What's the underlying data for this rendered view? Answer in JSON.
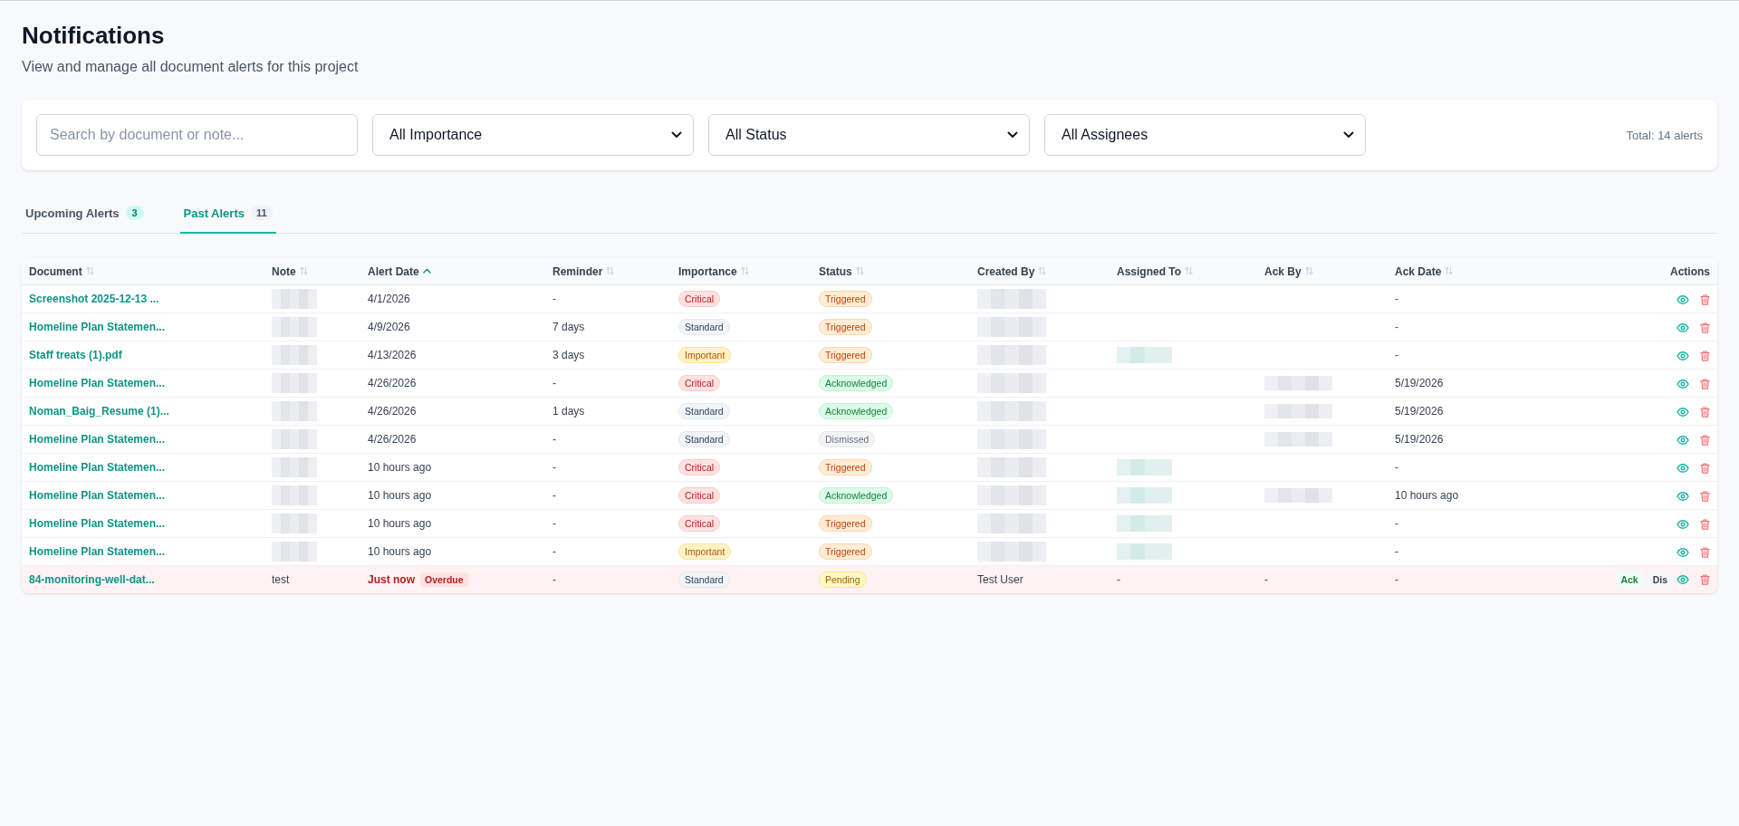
{
  "page": {
    "title": "Notifications",
    "subtitle": "View and manage all document alerts for this project"
  },
  "filters": {
    "search": {
      "placeholder": "Search by document or note..."
    },
    "dropdowns": [
      {
        "value": "All Importance"
      },
      {
        "value": "All Status"
      },
      {
        "value": "All Assignees"
      }
    ],
    "total": "Total: 14 alerts"
  },
  "tabs": [
    {
      "label": "Upcoming Alerts",
      "count": "3",
      "selected": false
    },
    {
      "label": "Past Alerts",
      "count": "11",
      "selected": true
    }
  ],
  "table": {
    "columns": [
      {
        "label": "Document",
        "sortable": true,
        "sorted": false
      },
      {
        "label": "Note",
        "sortable": true,
        "sorted": false
      },
      {
        "label": "Alert Date",
        "sortable": true,
        "sorted": true
      },
      {
        "label": "Reminder",
        "sortable": true,
        "sorted": false
      },
      {
        "label": "Importance",
        "sortable": true,
        "sorted": false
      },
      {
        "label": "Status",
        "sortable": true,
        "sorted": false
      },
      {
        "label": "Created By",
        "sortable": true,
        "sorted": false
      },
      {
        "label": "Assigned To",
        "sortable": true,
        "sorted": false
      },
      {
        "label": "Ack By",
        "sortable": true,
        "sorted": false
      },
      {
        "label": "Ack Date",
        "sortable": true,
        "sorted": false
      },
      {
        "label": "Actions",
        "sortable": false
      }
    ],
    "rows": [
      {
        "overdue": false,
        "document": "Screenshot 2025-12-13 ...",
        "note": {
          "redacted": true
        },
        "alert_date": "4/1/2026",
        "reminder": "-",
        "importance": {
          "label": "Critical",
          "kind": "critical"
        },
        "status": {
          "label": "Triggered",
          "kind": "triggered"
        },
        "created_by": {
          "redacted": true
        },
        "ack_date": "-"
      },
      {
        "overdue": false,
        "document": "Homeline Plan Statemen...",
        "note": {
          "redacted": true
        },
        "alert_date": "4/9/2026",
        "reminder": "7 days",
        "importance": {
          "label": "Standard",
          "kind": "standard"
        },
        "status": {
          "label": "Triggered",
          "kind": "triggered"
        },
        "created_by": {
          "redacted": true
        },
        "ack_date": "-"
      },
      {
        "overdue": false,
        "document": "Staff treats (1).pdf",
        "note": {
          "redacted": true
        },
        "alert_date": "4/13/2026",
        "reminder": "3 days",
        "importance": {
          "label": "Important",
          "kind": "important"
        },
        "status": {
          "label": "Triggered",
          "kind": "triggered"
        },
        "created_by": {
          "redacted": true
        },
        "assigned_to": {
          "redacted": true,
          "link": true
        },
        "ack_date": "-"
      },
      {
        "overdue": false,
        "document": "Homeline Plan Statemen...",
        "note": {
          "redacted": true
        },
        "alert_date": "4/26/2026",
        "reminder": "-",
        "importance": {
          "label": "Critical",
          "kind": "critical"
        },
        "status": {
          "label": "Acknowledged",
          "kind": "acknowledged"
        },
        "created_by": {
          "redacted": true
        },
        "ack_by": {
          "redacted": true
        },
        "ack_date": "5/19/2026"
      },
      {
        "overdue": false,
        "document": "Noman_Baig_Resume (1)...",
        "note": {
          "redacted": true
        },
        "alert_date": "4/26/2026",
        "reminder": "1 days",
        "importance": {
          "label": "Standard",
          "kind": "standard"
        },
        "status": {
          "label": "Acknowledged",
          "kind": "acknowledged"
        },
        "created_by": {
          "redacted": true
        },
        "ack_by": {
          "redacted": true
        },
        "ack_date": "5/19/2026"
      },
      {
        "overdue": false,
        "document": "Homeline Plan Statemen...",
        "note": {
          "redacted": true
        },
        "alert_date": "4/26/2026",
        "reminder": "-",
        "importance": {
          "label": "Standard",
          "kind": "standard"
        },
        "status": {
          "label": "Dismissed",
          "kind": "dismissed"
        },
        "created_by": {
          "redacted": true
        },
        "ack_by": {
          "redacted": true
        },
        "ack_date": "5/19/2026"
      },
      {
        "overdue": false,
        "document": "Homeline Plan Statemen...",
        "note": {
          "redacted": true
        },
        "alert_date": "10 hours ago",
        "reminder": "-",
        "importance": {
          "label": "Critical",
          "kind": "critical"
        },
        "status": {
          "label": "Triggered",
          "kind": "triggered"
        },
        "created_by": {
          "redacted": true
        },
        "assigned_to": {
          "redacted": true,
          "link": true
        },
        "ack_date": "-"
      },
      {
        "overdue": false,
        "document": "Homeline Plan Statemen...",
        "note": {
          "redacted": true
        },
        "alert_date": "10 hours ago",
        "reminder": "-",
        "importance": {
          "label": "Critical",
          "kind": "critical"
        },
        "status": {
          "label": "Acknowledged",
          "kind": "acknowledged"
        },
        "created_by": {
          "redacted": true
        },
        "assigned_to": {
          "redacted": true,
          "link": true
        },
        "ack_by": {
          "redacted": true
        },
        "ack_date": "10 hours ago"
      },
      {
        "overdue": false,
        "document": "Homeline Plan Statemen...",
        "note": {
          "redacted": true
        },
        "alert_date": "10 hours ago",
        "reminder": "-",
        "importance": {
          "label": "Critical",
          "kind": "critical"
        },
        "status": {
          "label": "Triggered",
          "kind": "triggered"
        },
        "created_by": {
          "redacted": true
        },
        "assigned_to": {
          "redacted": true,
          "link": true
        },
        "ack_date": "-"
      },
      {
        "overdue": false,
        "document": "Homeline Plan Statemen...",
        "note": {
          "redacted": true
        },
        "alert_date": "10 hours ago",
        "reminder": "-",
        "importance": {
          "label": "Important",
          "kind": "important"
        },
        "status": {
          "label": "Triggered",
          "kind": "triggered"
        },
        "created_by": {
          "redacted": true
        },
        "assigned_to": {
          "redacted": true,
          "link": true
        },
        "ack_date": "-"
      },
      {
        "overdue": true,
        "overdue_label": "Overdue",
        "document": "84-monitoring-well-dat...",
        "note": {
          "redacted": false,
          "text": "test"
        },
        "alert_date": "Just now",
        "reminder": "-",
        "importance": {
          "label": "Standard",
          "kind": "standard"
        },
        "status": {
          "label": "Pending",
          "kind": "pending"
        },
        "created_by": {
          "redacted": false,
          "text": "Test User"
        },
        "assigned_to": {
          "redacted": false,
          "text": "-"
        },
        "ack_by": {
          "redacted": false,
          "text": "-"
        },
        "ack_date": "-",
        "actions": [
          {
            "label": "Ack",
            "kind": "acknowledge"
          },
          {
            "label": "Dis",
            "kind": "dismiss"
          }
        ]
      }
    ]
  }
}
